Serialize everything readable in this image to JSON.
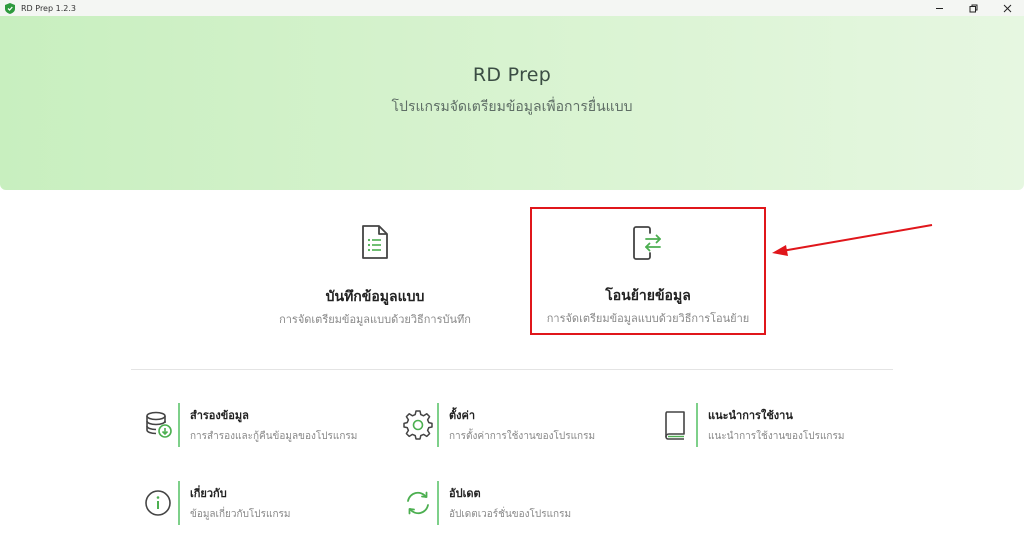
{
  "window": {
    "title": "RD Prep 1.2.3",
    "minimize": "–",
    "restore": "⧉",
    "close": "✕"
  },
  "hero": {
    "title": "RD Prep",
    "subtitle": "โปรแกรมจัดเตรียมข้อมูลเพื่อการยื่นแบบ"
  },
  "cards": {
    "record": {
      "icon": "document-list-icon",
      "title": "บันทึกข้อมูลแบบ",
      "desc": "การจัดเตรียมข้อมูลแบบด้วยวิธีการบันทึก"
    },
    "transfer": {
      "icon": "file-transfer-icon",
      "title": "โอนย้ายข้อมูล",
      "desc": "การจัดเตรียมข้อมูลแบบด้วยวิธีการโอนย้าย"
    }
  },
  "items": [
    {
      "icon": "database-backup-icon",
      "title": "สำรองข้อมูล",
      "desc": "การสำรองและกู้คืนข้อมูลของโปรแกรม"
    },
    {
      "icon": "gear-icon",
      "title": "ตั้งค่า",
      "desc": "การตั้งค่าการใช้งานของโปรแกรม"
    },
    {
      "icon": "book-icon",
      "title": "แนะนำการใช้งาน",
      "desc": "แนะนำการใช้งานของโปรแกรม"
    },
    {
      "icon": "info-icon",
      "title": "เกี่ยวกับ",
      "desc": "ข้อมูลเกี่ยวกับโปรแกรม"
    },
    {
      "icon": "refresh-icon",
      "title": "อัปเดต",
      "desc": "อัปเดตเวอร์ชั่นของโปรแกรม"
    }
  ],
  "colors": {
    "accent_green": "#4caf50",
    "highlight_red": "#e0161b",
    "hero_gradient_start": "#c8efbf",
    "hero_gradient_end": "#e6f7e1"
  }
}
